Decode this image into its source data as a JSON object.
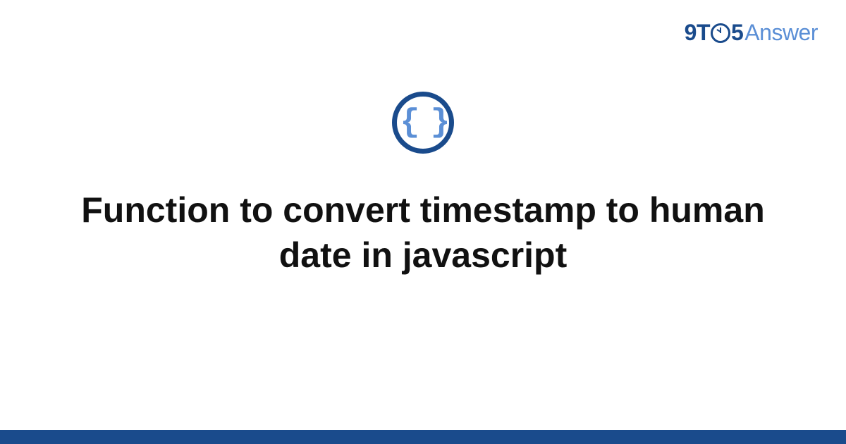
{
  "logo": {
    "part1": "9T",
    "part2": "5",
    "part3": "Answer"
  },
  "icon": {
    "glyph": "{ }",
    "name": "code-braces-icon"
  },
  "title": "Function to convert timestamp to human date in javascript",
  "colors": {
    "brand_dark": "#1a4b8c",
    "brand_light": "#5b8fd6",
    "text": "#111111",
    "background": "#ffffff"
  }
}
